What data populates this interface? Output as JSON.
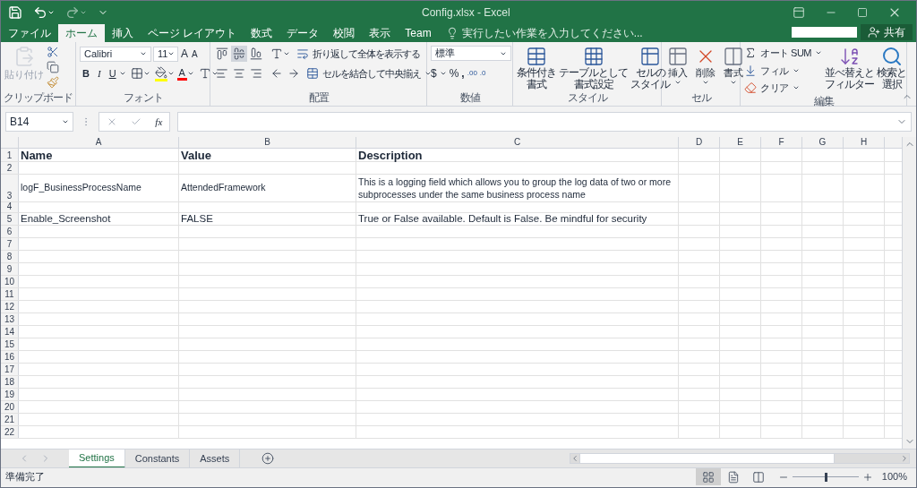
{
  "title_bar": {
    "title": "Config.xlsx - Excel"
  },
  "ribbon_tabs": [
    {
      "label": "ファイル",
      "selected": false
    },
    {
      "label": "ホーム",
      "selected": true
    },
    {
      "label": "挿入",
      "selected": false
    },
    {
      "label": "ページ レイアウト",
      "selected": false
    },
    {
      "label": "数式",
      "selected": false
    },
    {
      "label": "データ",
      "selected": false
    },
    {
      "label": "校閲",
      "selected": false
    },
    {
      "label": "表示",
      "selected": false
    },
    {
      "label": "Team",
      "selected": false
    }
  ],
  "tell_me": {
    "placeholder": "実行したい作業を入力してください..."
  },
  "share_button": "共有",
  "ribbon": {
    "clipboard": {
      "paste": "貼り付け",
      "label": "クリップボード"
    },
    "font": {
      "name": "Calibri",
      "size": "11",
      "grow": "A",
      "shrink": "A",
      "bold": "B",
      "italic": "I",
      "underline": "U",
      "font_color": "A",
      "label": "フォント"
    },
    "alignment": {
      "wrap": "折り返して全体を表示する",
      "merge": "セルを結合して中央揃え",
      "label": "配置"
    },
    "number": {
      "format": "標準",
      "currency": "$",
      "percent": "%",
      "comma": ",",
      "more_decimals": ".00",
      "fewer_decimals": ".0",
      "label": "数値"
    },
    "styles": {
      "buttons": [
        {
          "lines": [
            "条件付き",
            "書式"
          ]
        },
        {
          "lines": [
            "テーブルとして",
            "書式設定"
          ]
        },
        {
          "lines": [
            "セルの",
            "スタイル"
          ]
        }
      ],
      "label": "スタイル"
    },
    "cells": {
      "buttons": [
        "挿入",
        "削除",
        "書式"
      ],
      "label": "セル"
    },
    "editing": {
      "autosum": "オート SUM",
      "fill": "フィル",
      "clear": "クリア",
      "sort": [
        "並べ替えと",
        "フィルター"
      ],
      "find": [
        "検索と",
        "選択"
      ],
      "label": "編集"
    }
  },
  "formula_bar": {
    "name_box": "B14",
    "fx": "fx"
  },
  "sheet": {
    "columns": [
      "A",
      "B",
      "C",
      "D",
      "E",
      "F",
      "G",
      "H"
    ],
    "rows": [
      {
        "number": "1",
        "kind": "header",
        "cells": [
          "Name",
          "Value",
          "Description"
        ]
      },
      {
        "number": "2",
        "kind": "plain",
        "cells": []
      },
      {
        "number": "3",
        "kind": "wrapped",
        "cells": [
          "logF_BusinessProcessName",
          "AttendedFramework",
          "This is a logging field which allows you to group the log data of two or more subprocesses under the same business process name"
        ]
      },
      {
        "number": "4",
        "kind": "short",
        "cells": []
      },
      {
        "number": "5",
        "kind": "plain",
        "cells": [
          "Enable_Screenshot",
          "FALSE",
          "True or False available. Default is False. Be mindful for security"
        ]
      },
      {
        "number": "6",
        "kind": "plain",
        "cells": []
      },
      {
        "number": "7",
        "kind": "plain",
        "cells": []
      },
      {
        "number": "8",
        "kind": "plain",
        "cells": []
      },
      {
        "number": "9",
        "kind": "plain",
        "cells": []
      },
      {
        "number": "10",
        "kind": "plain",
        "cells": []
      },
      {
        "number": "11",
        "kind": "plain",
        "cells": []
      },
      {
        "number": "12",
        "kind": "plain",
        "cells": []
      },
      {
        "number": "13",
        "kind": "plain",
        "cells": []
      },
      {
        "number": "14",
        "kind": "plain",
        "cells": []
      },
      {
        "number": "15",
        "kind": "plain",
        "cells": []
      },
      {
        "number": "16",
        "kind": "plain",
        "cells": []
      },
      {
        "number": "17",
        "kind": "plain",
        "cells": []
      },
      {
        "number": "18",
        "kind": "plain",
        "cells": []
      },
      {
        "number": "19",
        "kind": "plain",
        "cells": []
      },
      {
        "number": "20",
        "kind": "plain",
        "cells": []
      },
      {
        "number": "21",
        "kind": "plain",
        "cells": []
      },
      {
        "number": "22",
        "kind": "plain",
        "cells": []
      }
    ]
  },
  "sheet_tabs": [
    {
      "label": "Settings",
      "selected": true
    },
    {
      "label": "Constants",
      "selected": false
    },
    {
      "label": "Assets",
      "selected": false
    }
  ],
  "status_bar": {
    "text": "準備完了",
    "views": [
      {
        "kind": "normal",
        "selected": true
      },
      {
        "kind": "page_layout",
        "selected": false
      },
      {
        "kind": "page_break",
        "selected": false
      }
    ],
    "zoom": {
      "level": 0.5,
      "text": "100%"
    }
  }
}
